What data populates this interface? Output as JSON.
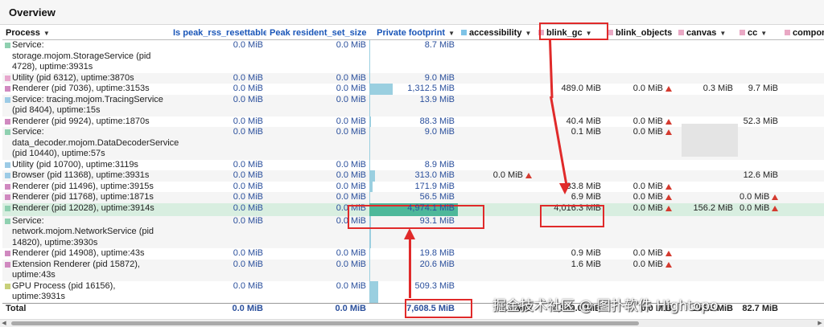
{
  "section": {
    "title": "Overview"
  },
  "columns": {
    "process": "Process",
    "peak_rss_resettable": "Is peak_rss_resettable",
    "peak_rss": "Peak resident_set_size",
    "private_footprint": "Private footprint",
    "accessibility": "accessibility",
    "blink_gc": "blink_gc",
    "blink_objects": "blink_objects",
    "canvas": "canvas",
    "cc": "cc",
    "components": "compone"
  },
  "colors": {
    "accessibility": "#7ec3e6",
    "blink_gc": "#e9a8c4",
    "blink_objects": "#e9a8c4",
    "canvas": "#e9a8c4",
    "cc": "#e9a8c4",
    "components": "#e9a8c4",
    "highlight": "#e02a2a"
  },
  "rows": [
    {
      "color": "#8fd0b0",
      "name": "Service: storage.mojom.StorageService (pid 4728), uptime:3931s",
      "rss_reset": "0.0 MiB",
      "peak_rss": "0.0 MiB",
      "pf": "8.7 MiB",
      "pf_fraction": 0.002
    },
    {
      "color": "#e7a7cd",
      "name": "Utility (pid 6312), uptime:3870s",
      "rss_reset": "0.0 MiB",
      "peak_rss": "0.0 MiB",
      "pf": "9.0 MiB",
      "pf_fraction": 0.002
    },
    {
      "color": "#d089c0",
      "name": "Renderer (pid 7036), uptime:3153s",
      "rss_reset": "0.0 MiB",
      "peak_rss": "0.0 MiB",
      "pf": "1,312.5 MiB",
      "pf_fraction": 0.26,
      "blink_gc": "489.0 MiB",
      "blink_objects": "0.0 MiB",
      "blink_objects_warn": true,
      "canvas": "0.3 MiB",
      "cc": "9.7 MiB"
    },
    {
      "color": "#9ccbe6",
      "name": "Service: tracing.mojom.TracingService (pid 8404), uptime:15s",
      "rss_reset": "0.0 MiB",
      "peak_rss": "0.0 MiB",
      "pf": "13.9 MiB",
      "pf_fraction": 0.003
    },
    {
      "color": "#d089c0",
      "name": "Renderer (pid 9924), uptime:1870s",
      "rss_reset": "0.0 MiB",
      "peak_rss": "0.0 MiB",
      "pf": "88.3 MiB",
      "pf_fraction": 0.018,
      "blink_gc": "40.4 MiB",
      "blink_objects": "0.0 MiB",
      "blink_objects_warn": true,
      "cc": "52.3 MiB"
    },
    {
      "color": "#8fd0b0",
      "name": "Service: data_decoder.mojom.DataDecoderService (pid 10440), uptime:57s",
      "rss_reset": "0.0 MiB",
      "peak_rss": "0.0 MiB",
      "pf": "9.0 MiB",
      "pf_fraction": 0.002,
      "blink_gc": "0.1 MiB",
      "blink_objects": "0.0 MiB",
      "blink_objects_warn": true
    },
    {
      "color": "#9ccbe6",
      "name": "Utility (pid 10700), uptime:3119s",
      "rss_reset": "0.0 MiB",
      "peak_rss": "0.0 MiB",
      "pf": "8.9 MiB",
      "pf_fraction": 0.002
    },
    {
      "color": "#9ccbe6",
      "name": "Browser (pid 11368), uptime:3931s",
      "rss_reset": "0.0 MiB",
      "peak_rss": "0.0 MiB",
      "pf": "313.0 MiB",
      "pf_fraction": 0.063,
      "accessibility": "0.0 MiB",
      "accessibility_warn": true,
      "cc": "12.6 MiB",
      "components": "0."
    },
    {
      "color": "#d089c0",
      "name": "Renderer (pid 11496), uptime:3915s",
      "rss_reset": "0.0 MiB",
      "peak_rss": "0.0 MiB",
      "pf": "171.9 MiB",
      "pf_fraction": 0.035,
      "blink_gc": "33.8 MiB",
      "blink_objects": "0.0 MiB",
      "blink_objects_warn": true
    },
    {
      "color": "#d089c0",
      "name": "Renderer (pid 11768), uptime:1871s",
      "rss_reset": "0.0 MiB",
      "peak_rss": "0.0 MiB",
      "pf": "56.5 MiB",
      "pf_fraction": 0.011,
      "blink_gc": "6.9 MiB",
      "blink_objects": "0.0 MiB",
      "blink_objects_warn": true,
      "cc": "0.0 MiB",
      "cc_warn": true
    },
    {
      "color": "#8fd0b0",
      "name": "Renderer (pid 12028), uptime:3914s",
      "rss_reset": "0.0 MiB",
      "peak_rss": "0.0 MiB",
      "pf": "4,974.1 MiB",
      "pf_fraction": 1.0,
      "selected": true,
      "blink_gc": "4,016.3 MiB",
      "blink_objects": "0.0 MiB",
      "blink_objects_warn": true,
      "canvas": "156.2 MiB",
      "cc": "0.0 MiB",
      "cc_warn": true
    },
    {
      "color": "#8fd0b0",
      "name": "Service: network.mojom.NetworkService (pid 14820), uptime:3930s",
      "rss_reset": "0.0 MiB",
      "peak_rss": "0.0 MiB",
      "pf": "93.1 MiB",
      "pf_fraction": 0.019
    },
    {
      "color": "#d089c0",
      "name": "Renderer (pid 14908), uptime:43s",
      "rss_reset": "0.0 MiB",
      "peak_rss": "0.0 MiB",
      "pf": "19.8 MiB",
      "pf_fraction": 0.004,
      "blink_gc": "0.9 MiB",
      "blink_objects": "0.0 MiB",
      "blink_objects_warn": true
    },
    {
      "color": "#d089c0",
      "name": "Extension Renderer (pid 15872), uptime:43s",
      "rss_reset": "0.0 MiB",
      "peak_rss": "0.0 MiB",
      "pf": "20.6 MiB",
      "pf_fraction": 0.004,
      "blink_gc": "1.6 MiB",
      "blink_objects": "0.0 MiB",
      "blink_objects_warn": true
    },
    {
      "color": "#c8d07a",
      "name": "GPU Process (pid 16156), uptime:3931s",
      "rss_reset": "0.0 MiB",
      "peak_rss": "0.0 MiB",
      "pf": "509.3 MiB",
      "pf_fraction": 0.102
    }
  ],
  "total": {
    "label": "Total",
    "rss_reset": "0.0 MiB",
    "peak_rss": "0.0 MiB",
    "pf": "7,608.5 MiB",
    "accessibility": "0.0 MiB",
    "blink_gc": "4,589.0 MiB",
    "blink_objects": "0.0 MiB",
    "canvas": "156.5 MiB",
    "cc": "82.7 MiB"
  },
  "watermark": "掘金技术社区 @ 图扑软件 Hightopo"
}
